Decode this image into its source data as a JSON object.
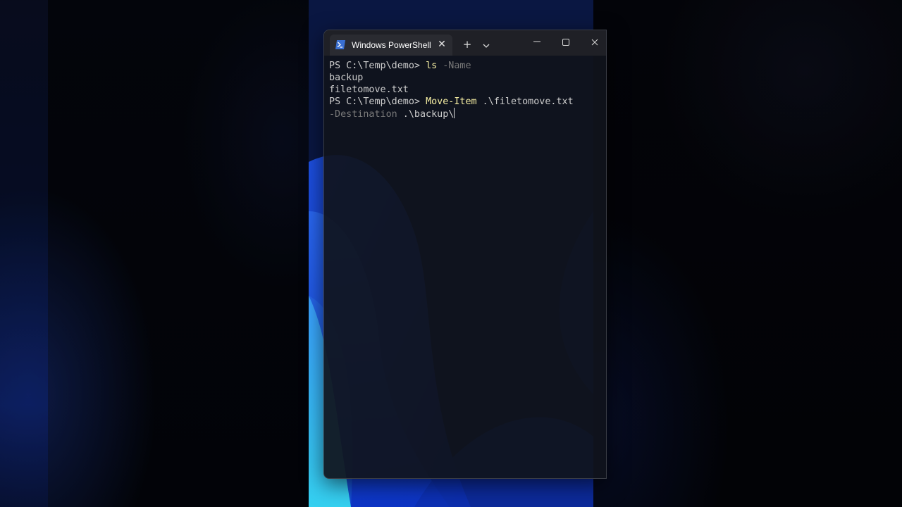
{
  "window": {
    "tab_title": "Windows PowerShell",
    "tab_close_glyph": "✕",
    "new_tab_glyph": "+",
    "icons": {
      "tab": "powershell-icon",
      "dropdown": "chevron-down-icon",
      "minimize": "minimize-icon",
      "maximize": "maximize-icon",
      "close": "close-icon"
    }
  },
  "console": {
    "lines": [
      {
        "prompt": "PS C:\\Temp\\demo> ",
        "command": "ls",
        "param": " -Name",
        "arg": ""
      },
      {
        "output": "backup"
      },
      {
        "output": "filetomove.txt"
      },
      {
        "prompt": "PS C:\\Temp\\demo> ",
        "command": "Move-Item",
        "param": "",
        "arg": " .\\filetomove.txt"
      },
      {
        "param": "-Destination",
        "arg": " .\\backup\\"
      }
    ]
  },
  "colors": {
    "command": "#f9f1a5",
    "parameter": "#7a7a7a",
    "text": "#cccccc",
    "titlebar": "#1f2026",
    "tab": "#2a2b31"
  }
}
